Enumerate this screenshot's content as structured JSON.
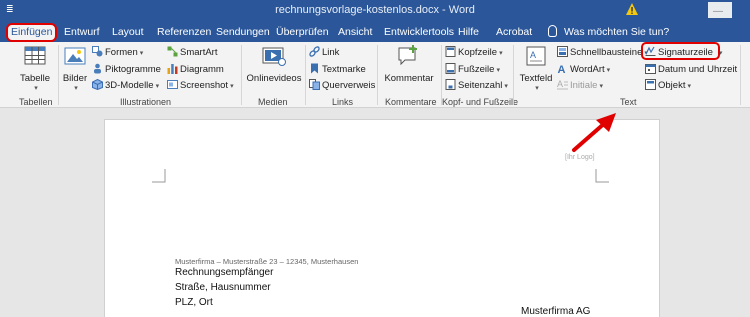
{
  "window": {
    "title": "rechnungsvorlage-kostenlos.docx  -  Word",
    "qat_glyph": "≣",
    "min_glyph": "—"
  },
  "tabs": [
    "Einfügen",
    "Entwurf",
    "Layout",
    "Referenzen",
    "Sendungen",
    "Überprüfen",
    "Ansicht",
    "Entwicklertools",
    "Hilfe",
    "Acrobat"
  ],
  "tell_me": "Was möchten Sie tun?",
  "ribbon": {
    "tabellen": {
      "table_btn": "Tabelle",
      "label": "Tabellen"
    },
    "illustrationen": {
      "bilder": "Bilder",
      "formen": "Formen",
      "piktogramme": "Piktogramme",
      "modelle3d": "3D-Modelle",
      "smartart": "SmartArt",
      "diagramm": "Diagramm",
      "screenshot": "Screenshot",
      "label": "Illustrationen"
    },
    "medien": {
      "onlinevideos": "Onlinevideos",
      "label": "Medien"
    },
    "links": {
      "link": "Link",
      "textmarke": "Textmarke",
      "querverweis": "Querverweis",
      "label": "Links"
    },
    "kommentare": {
      "kommentar": "Kommentar",
      "label": "Kommentare"
    },
    "kopf": {
      "kopfzeile": "Kopfzeile",
      "fusszeile": "Fußzeile",
      "seitenzahl": "Seitenzahl",
      "label": "Kopf- und Fußzeile"
    },
    "text": {
      "textfeld": "Textfeld",
      "schnellbausteine": "Schnellbausteine",
      "wordart": "WordArt",
      "initiale": "Initiale",
      "signaturzeile": "Signaturzeile",
      "datum": "Datum und Uhrzeit",
      "objekt": "Objekt",
      "label": "Text"
    }
  },
  "document": {
    "logo_placeholder": "[Ihr Logo]",
    "sender_line": "Musterfirma – Musterstraße 23 – 12345, Musterhausen",
    "recipient": [
      "Rechnungsempfänger",
      "Straße, Hausnummer",
      "PLZ, Ort"
    ],
    "company": "Musterfirma AG"
  },
  "colors": {
    "word_blue": "#2b579a",
    "highlight_red": "#e00000"
  }
}
